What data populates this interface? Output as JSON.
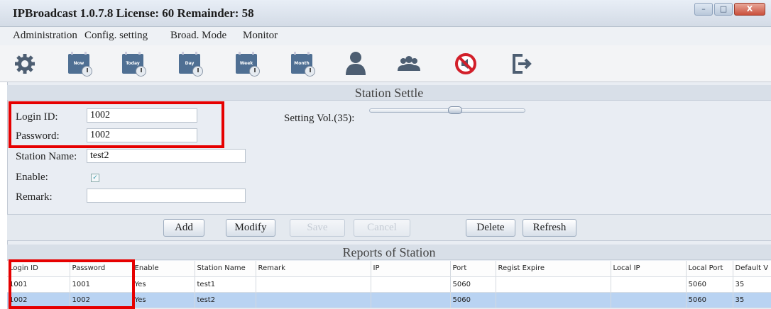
{
  "window": {
    "title": "IPBroadcast 1.0.7.8 License: 60 Remainder: 58",
    "buttons": {
      "minimize": "–",
      "maximize": "□",
      "close": "X"
    }
  },
  "menu": [
    "Administration",
    "Config. setting",
    "Broad. Mode",
    "Monitor"
  ],
  "toolbar": {
    "icons": [
      "gear-icon",
      "calendar-now-icon",
      "calendar-today-icon",
      "calendar-day-icon",
      "calendar-week-icon",
      "calendar-month-icon",
      "user-icon",
      "users-group-icon",
      "mute-icon",
      "exit-icon"
    ],
    "calendar_labels": {
      "now": "Now",
      "today": "Today",
      "day": "Day",
      "week": "Week",
      "month": "Month"
    }
  },
  "station_settle": {
    "header": "Station Settle",
    "login_id_label": "Login ID:",
    "login_id_value": "1002",
    "password_label": "Password:",
    "password_value": "1002",
    "station_name_label": "Station Name:",
    "station_name_value": "test2",
    "enable_label": "Enable:",
    "enable_checked": true,
    "remark_label": "Remark:",
    "remark_value": "",
    "volume_label": "Setting Vol.(35):",
    "volume_value": 35
  },
  "actions": {
    "add": "Add",
    "modify": "Modify",
    "save": "Save",
    "cancel": "Cancel",
    "delete": "Delete",
    "refresh": "Refresh"
  },
  "reports": {
    "header": "Reports of Station",
    "columns": [
      "Login ID",
      "Password",
      "Enable",
      "Station Name",
      "Remark",
      "IP",
      "Port",
      "Regist Expire",
      "Local IP",
      "Local Port",
      "Default V"
    ],
    "rows": [
      [
        "1001",
        "1001",
        "Yes",
        "test1",
        "",
        "",
        "5060",
        "",
        "",
        "5060",
        "35"
      ],
      [
        "1002",
        "1002",
        "Yes",
        "test2",
        "",
        "",
        "5060",
        "",
        "",
        "5060",
        "35"
      ]
    ]
  },
  "colors": {
    "highlight_box": "#e60000",
    "selected_row": "#b9d3f2",
    "calendar_icon": "#4f6f93"
  }
}
